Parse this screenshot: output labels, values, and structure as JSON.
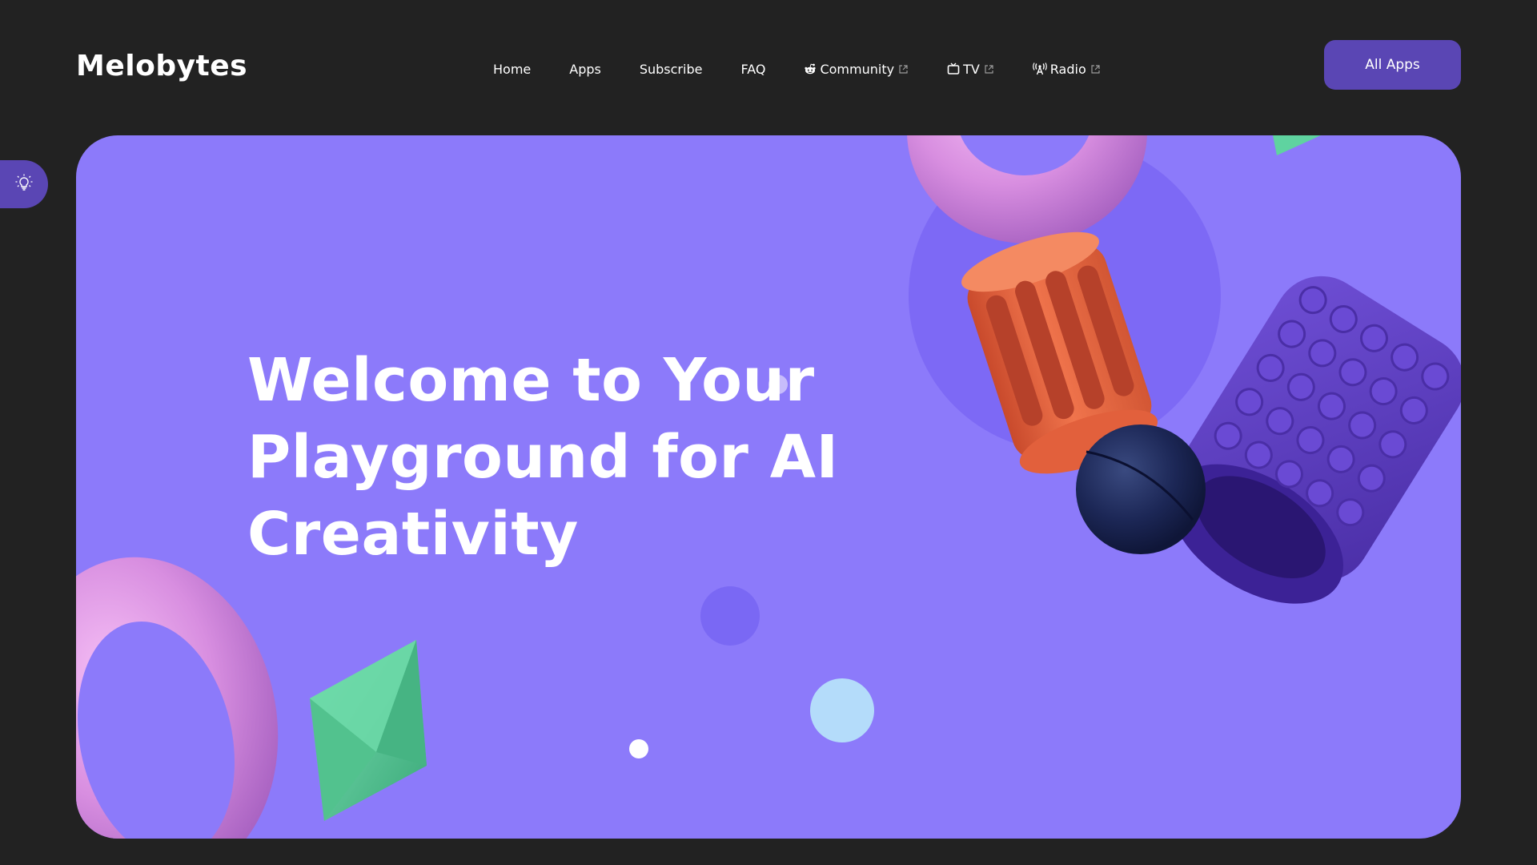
{
  "header": {
    "logo": "Melobytes",
    "nav": [
      {
        "label": "Home",
        "icon": null,
        "external": false
      },
      {
        "label": "Apps",
        "icon": null,
        "external": false
      },
      {
        "label": "Subscribe",
        "icon": null,
        "external": false
      },
      {
        "label": "FAQ",
        "icon": null,
        "external": false
      },
      {
        "label": "Community",
        "icon": "reddit-icon",
        "external": true
      },
      {
        "label": "TV",
        "icon": "tv-icon",
        "external": true
      },
      {
        "label": "Radio",
        "icon": "radio-antenna-icon",
        "external": true
      }
    ],
    "cta_label": "All Apps"
  },
  "side_toggle": {
    "icon": "lightbulb-icon"
  },
  "hero": {
    "title_lines": [
      "Welcome to Your",
      "Playground for AI",
      "Creativity"
    ]
  },
  "colors": {
    "background": "#222222",
    "hero": "#8c7afa",
    "accent": "#5a46b4",
    "text": "#ffffff",
    "torus": "#d98fe0",
    "cylinder_orange": "#e8603c",
    "cylinder_purple": "#5a3cc0",
    "sphere_navy": "#1a2450",
    "gem_green": "#52c896",
    "bubble_light": "#b4dcfa"
  }
}
